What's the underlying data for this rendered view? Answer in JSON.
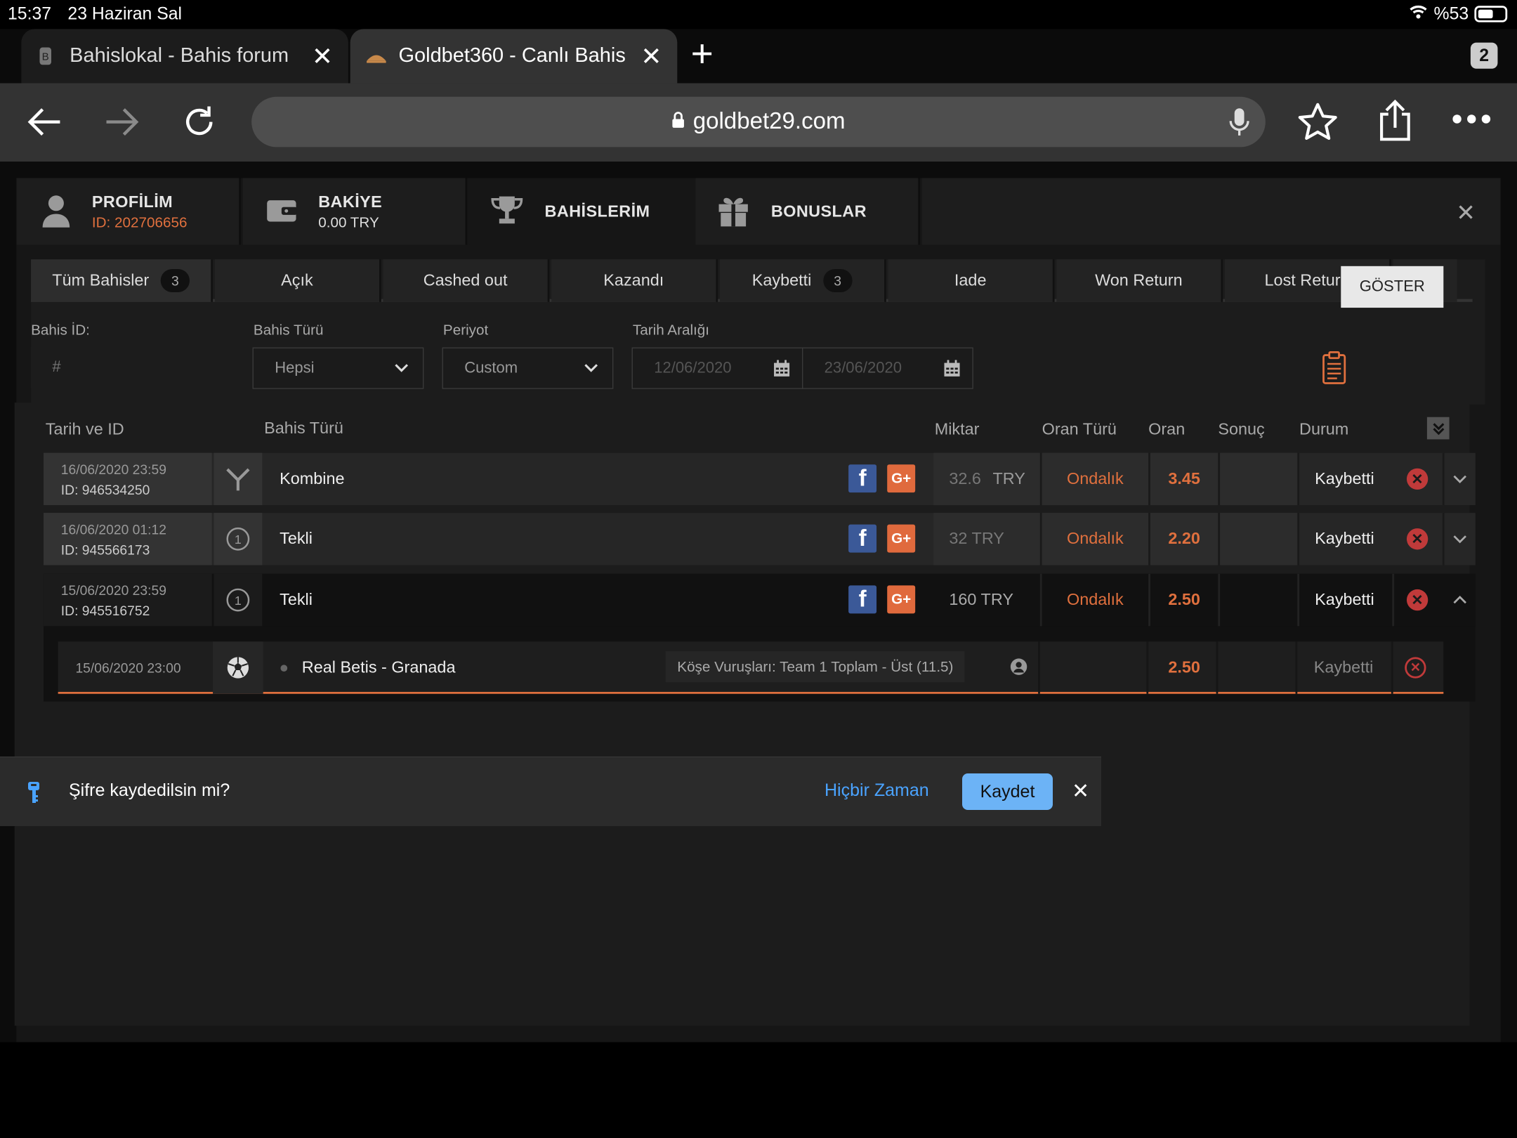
{
  "status": {
    "time": "15:37",
    "date": "23 Haziran Sal",
    "battery": "%53"
  },
  "browser": {
    "tabs": [
      {
        "title": "Bahislokal - Bahis forum",
        "active": false
      },
      {
        "title": "Goldbet360 - Canlı Bahis",
        "active": true
      }
    ],
    "tab_count": "2",
    "url": "goldbet29.com"
  },
  "panel": {
    "tabs": {
      "profile": {
        "label": "PROFİLİM",
        "sub": "ID: 202706656"
      },
      "balance": {
        "label": "BAKİYE",
        "sub": "0.00 TRY"
      },
      "bets": {
        "label": "BAHİSLERİM"
      },
      "bonus": {
        "label": "BONUSLAR"
      }
    },
    "filter_tabs": [
      {
        "label": "Tüm Bahisler",
        "count": "3"
      },
      {
        "label": "Açık"
      },
      {
        "label": "Cashed out"
      },
      {
        "label": "Kazandı"
      },
      {
        "label": "Kaybetti",
        "count": "3"
      },
      {
        "label": "Iade"
      },
      {
        "label": "Won Return"
      },
      {
        "label": "Lost Return"
      }
    ],
    "filters": {
      "bet_id_label": "Bahis İD:",
      "bet_id_placeholder": "#",
      "bet_type_label": "Bahis Türü",
      "bet_type_value": "Hepsi",
      "period_label": "Periyot",
      "period_value": "Custom",
      "date_range_label": "Tarih Aralığı",
      "date_from": "12/06/2020",
      "date_to": "23/06/2020",
      "show_button": "GÖSTER"
    },
    "table": {
      "headers": {
        "date_id": "Tarih ve ID",
        "bet_type": "Bahis Türü",
        "amount": "Miktar",
        "odds_type": "Oran Türü",
        "odds": "Oran",
        "result": "Sonuç",
        "status": "Durum"
      },
      "rows": [
        {
          "date": "16/06/2020 23:59",
          "id": "ID: 946534250",
          "type": "Kombine",
          "amount": "32.6",
          "currency": "TRY",
          "odds_type": "Ondalık",
          "odds": "3.45",
          "status": "Kaybetti"
        },
        {
          "date": "16/06/2020 01:12",
          "id": "ID: 945566173",
          "type": "Tekli",
          "amount": "32 TRY",
          "odds_type": "Ondalık",
          "odds": "2.20",
          "status": "Kaybetti"
        },
        {
          "date": "15/06/2020 23:59",
          "id": "ID: 945516752",
          "type": "Tekli",
          "amount": "160 TRY",
          "odds_type": "Ondalık",
          "odds": "2.50",
          "status": "Kaybetti"
        }
      ],
      "detail": {
        "date": "15/06/2020 23:00",
        "match": "Real Betis - Granada",
        "market": "Köşe Vuruşları: Team 1 Toplam - Üst (11.5)",
        "odds": "2.50",
        "status": "Kaybetti"
      }
    }
  },
  "password_prompt": {
    "question": "Şifre kaydedilsin mi?",
    "never": "Hiçbir Zaman",
    "save": "Kaydet"
  },
  "colors": {
    "accent": "#e0703e",
    "ios_blue": "#4aa3ff",
    "loss_red": "#c03a3a"
  }
}
